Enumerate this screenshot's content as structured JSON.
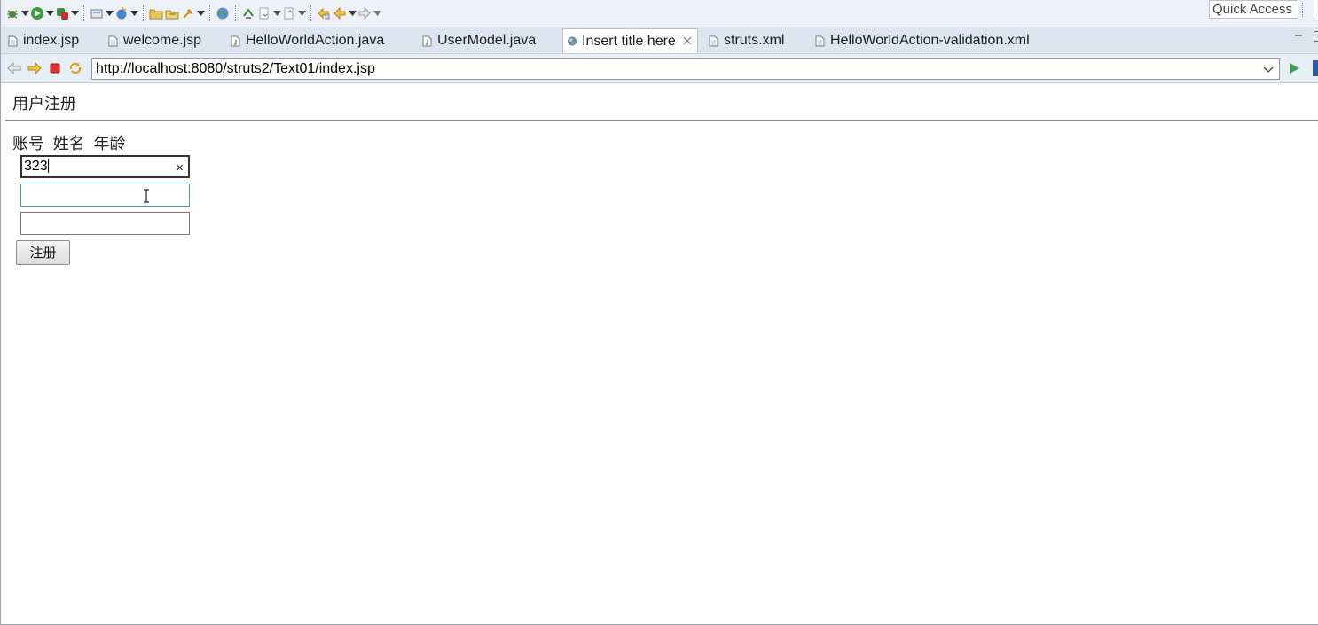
{
  "toolbar": {
    "quick_access_label": "Quick Access",
    "icons": [
      "debug-icon",
      "run-icon",
      "external-tools-icon",
      "new-server-icon",
      "new-wizard-icon",
      "open-folder-icon",
      "open-task-icon",
      "search-icon",
      "web-browser-icon",
      "refresh-icon",
      "next-annotation-icon",
      "prev-annotation-icon",
      "last-edit-icon",
      "back-icon",
      "forward-icon"
    ]
  },
  "tabs": [
    {
      "label": "index.jsp",
      "icon": "jsp-file-icon"
    },
    {
      "label": "welcome.jsp",
      "icon": "jsp-file-icon"
    },
    {
      "label": "HelloWorldAction.java",
      "icon": "java-file-icon"
    },
    {
      "label": "UserModel.java",
      "icon": "java-file-icon"
    },
    {
      "label": "Insert title here",
      "icon": "globe-icon",
      "active": true
    },
    {
      "label": "struts.xml",
      "icon": "xml-file-icon"
    },
    {
      "label": "HelloWorldAction-validation.xml",
      "icon": "xml-file-icon"
    }
  ],
  "browser": {
    "url": "http://localhost:8080/struts2/Text01/index.jsp"
  },
  "page": {
    "title": "用户注册",
    "field_labels": [
      "账号",
      "姓名",
      "年龄"
    ],
    "account_value": "323",
    "clear_symbol": "×",
    "name_value": "",
    "age_value": "",
    "submit_label": "注册"
  },
  "colors": {
    "focus_border": "#3a9ad9",
    "tabbar_bg": "#dce6f1",
    "toolbar_bg": "#edf1f7"
  }
}
